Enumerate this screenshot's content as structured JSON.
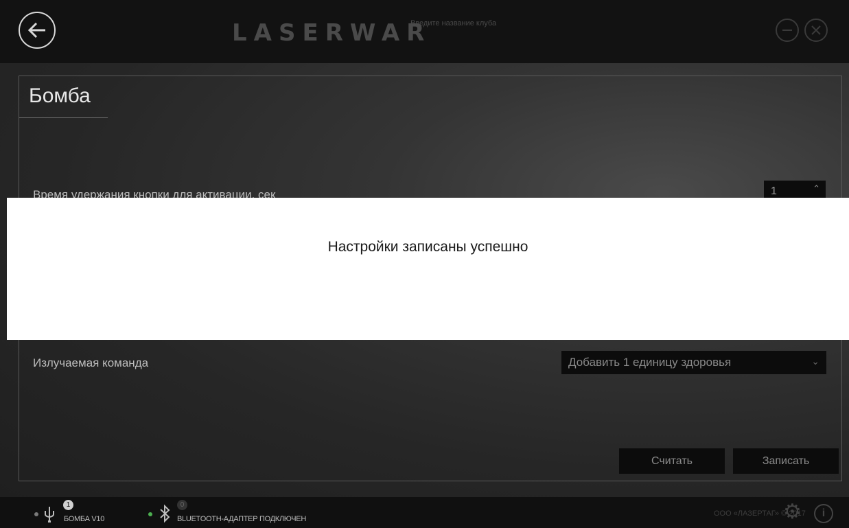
{
  "header": {
    "logo_text": "LASERWAR",
    "club_name_placeholder": "Введите название клуба"
  },
  "page": {
    "title": "Бомба"
  },
  "settings": {
    "hold_time_label": "Время удержания кнопки для активации, сек",
    "hold_time_value": "1",
    "emitted_command_label": "Излучаемая команда",
    "emitted_command_value": "Добавить 1 единицу здоровья"
  },
  "buttons": {
    "read_label": "Считать",
    "write_label": "Записать"
  },
  "toast": {
    "message": "Настройки записаны успешно"
  },
  "status": {
    "usb_badge": "1",
    "usb_device": "БОМБА V10",
    "bt_badge": "0",
    "bt_status": "BLUETOOTH-АДАПТЕР ПОДКЛЮЧЕН",
    "copyright": "ООО «ЛАЗЕРТАГ» © 2017"
  },
  "colors": {
    "usb_dot": "#7a7a7a",
    "bt_dot": "#4caf50",
    "toast_bg": "#ffffff"
  },
  "icons": [
    "back-arrow-icon",
    "minimize-icon",
    "close-icon",
    "usb-icon",
    "bluetooth-icon",
    "gear-icon",
    "info-icon",
    "chevron-down-icon",
    "chevron-up-icon"
  ]
}
